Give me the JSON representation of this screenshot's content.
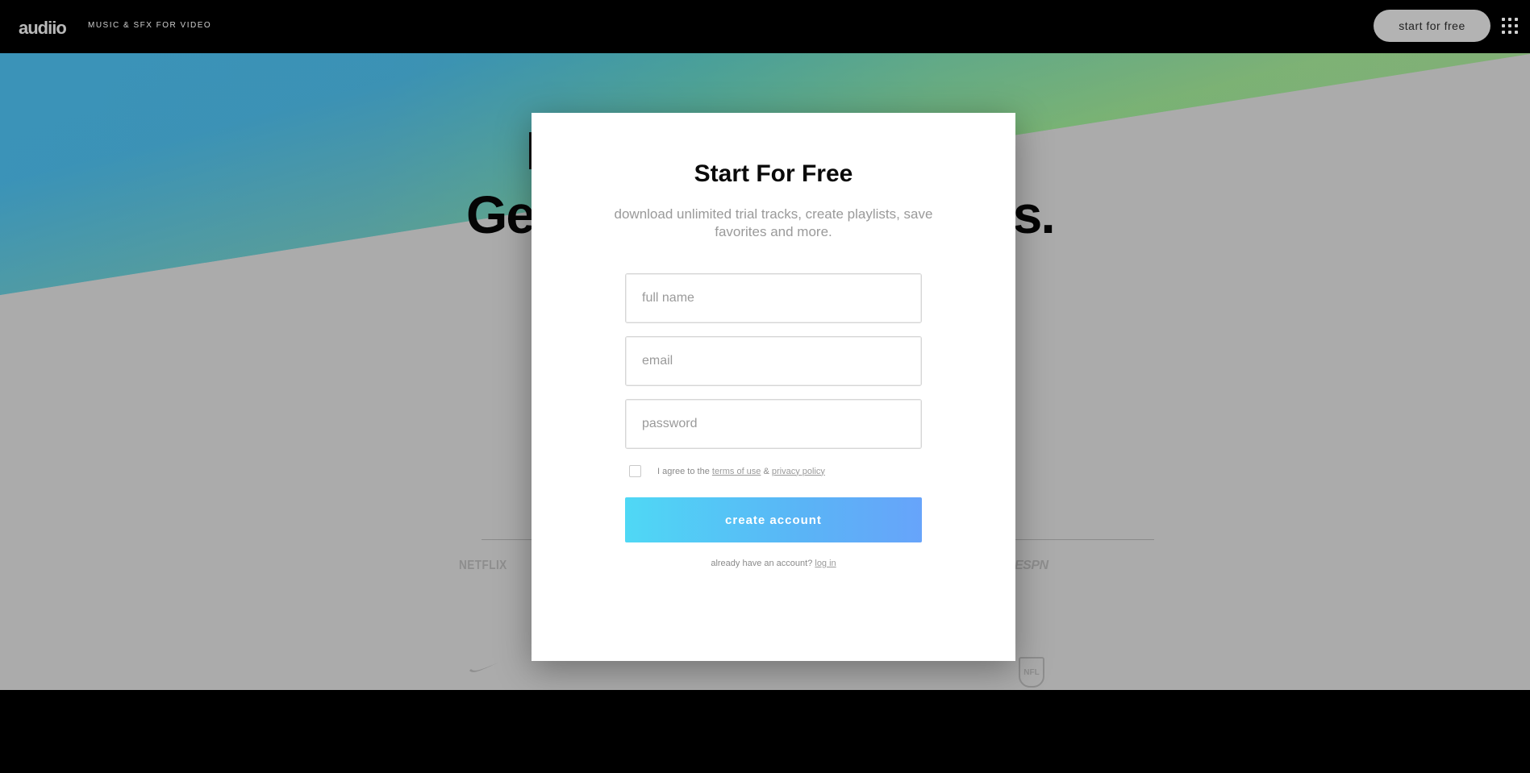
{
  "header": {
    "logo": "audiio",
    "tagline": "MUSIC & SFX FOR VIDEO",
    "start_button": "start for free",
    "menu_icon": "grid-menu-icon"
  },
  "hero": {
    "heading_left": "Ge",
    "heading_right": "rs.",
    "brands": [
      "NETFLIX",
      "ESPN",
      "NFL"
    ]
  },
  "modal": {
    "title": "Start For Free",
    "subtitle": "download unlimited trial tracks, create playlists, save favorites and more.",
    "full_name_placeholder": "full name",
    "email_placeholder": "email",
    "password_placeholder": "password",
    "agree_prefix": "I agree to the",
    "terms_link": "terms of use",
    "amp": "&",
    "privacy_link": "privacy policy",
    "submit": "create account",
    "login_prefix": "already have an account?",
    "login_link": "log in"
  },
  "colors": {
    "accent_start": "#4fd8f5",
    "accent_end": "#67a4fa",
    "overlay": "#ababab"
  }
}
